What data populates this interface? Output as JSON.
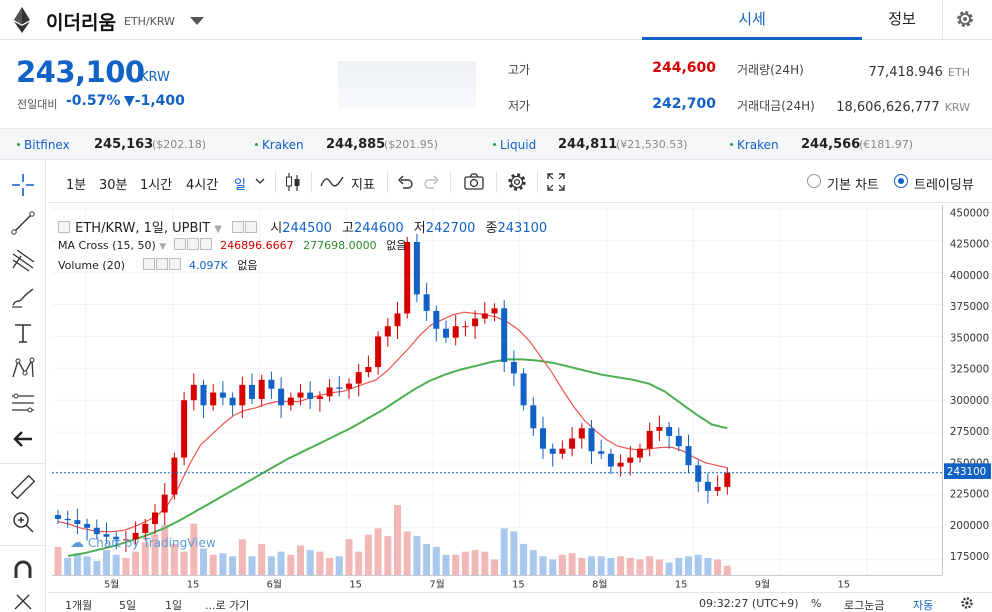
{
  "header": {
    "coin_name": "이더리움",
    "pair": "ETH/KRW",
    "tab_price": "시세",
    "tab_info": "정보"
  },
  "summary": {
    "price": "243,100",
    "currency": "KRW",
    "change_label": "전일대비",
    "change_pct": "-0.57%",
    "change_amt": "▼-1,400",
    "high_label": "고가",
    "high": "244,600",
    "low_label": "저가",
    "low": "242,700",
    "vol_label": "거래량(24H)",
    "vol": "77,418.946",
    "vol_unit": "ETH",
    "amt_label": "거래대금(24H)",
    "amt": "18,606,626,777",
    "amt_unit": "KRW",
    "colors": {
      "up": "#d60000",
      "down": "#1261c4"
    }
  },
  "ticker": [
    {
      "exchange": "Bitfinex",
      "price": "245,163",
      "usd": "($202.18)"
    },
    {
      "exchange": "Kraken",
      "price": "244,885",
      "usd": "($201.95)"
    },
    {
      "exchange": "Liquid",
      "price": "244,811",
      "usd": "(¥21,530.53)"
    },
    {
      "exchange": "Kraken",
      "price": "244,566",
      "usd": "(€181.97)"
    }
  ],
  "left_tools": [
    "crosshair-icon",
    "trend-line-icon",
    "pitchfork-icon",
    "brush-icon",
    "text-icon",
    "pattern-icon",
    "fib-icon",
    "back-arrow-icon",
    "ruler-icon",
    "zoom-icon",
    "magnet-icon",
    "trash-icon"
  ],
  "toolbar": {
    "intervals": [
      "1분",
      "30분",
      "1시간",
      "4시간",
      "일"
    ],
    "indicators": "지표",
    "basic_chart": "기본 차트",
    "tradingview": "트레이딩뷰"
  },
  "legend": {
    "title": "ETH/KRW, 1일, UPBIT",
    "o_label": "시",
    "o": "244500",
    "h_label": "고",
    "h": "244600",
    "l_label": "저",
    "l": "242700",
    "c_label": "종",
    "c": "243100",
    "ma_label": "MA Cross (15, 50)",
    "ma1": "246896.6667",
    "ma2": "277698.0000",
    "ma_none": "없음",
    "vol_label": "Volume (20)",
    "vol": "4.097K",
    "vol_none": "없음",
    "watermark": "Chart by TradingView"
  },
  "bottom": {
    "ranges": [
      "1개월",
      "5일",
      "1일",
      "...로 가기"
    ],
    "time": "09:32:27 (UTC+9)",
    "pct": "%",
    "log": "로그눈금",
    "auto": "자동"
  },
  "chart_data": {
    "type": "candlestick",
    "title": "ETH/KRW, 1일, UPBIT",
    "y_ticks": [
      175000,
      200000,
      225000,
      250000,
      275000,
      300000,
      325000,
      350000,
      375000,
      400000,
      425000,
      450000
    ],
    "y_range": [
      163000,
      453000
    ],
    "x_ticks": [
      "5월",
      "15",
      "6월",
      "15",
      "7월",
      "15",
      "8월",
      "15",
      "9월",
      "15"
    ],
    "last_price": 243100,
    "close_path": [
      207000,
      206000,
      203000,
      200000,
      195000,
      193000,
      191000,
      191000,
      196000,
      203000,
      212000,
      226000,
      255000,
      300000,
      312000,
      296000,
      306000,
      302000,
      296000,
      312000,
      301000,
      316000,
      309000,
      296000,
      302000,
      306000,
      301000,
      303000,
      310000,
      309000,
      313000,
      322000,
      326000,
      350000,
      358000,
      368000,
      424000,
      383000,
      370000,
      356000,
      349000,
      358000,
      358000,
      364000,
      368000,
      372000,
      330000,
      321000,
      296000,
      278000,
      262000,
      258000,
      262000,
      270000,
      278000,
      260000,
      258000,
      248000,
      251000,
      255000,
      262000,
      276000,
      279000,
      272000,
      264000,
      249000,
      236000,
      229000,
      232000,
      243100
    ],
    "ma_fast_path": [
      205000,
      203000,
      200000,
      198000,
      197000,
      197000,
      198000,
      201000,
      205000,
      209000,
      218000,
      232000,
      250000,
      265000,
      273000,
      281000,
      288000,
      292000,
      294000,
      297000,
      299000,
      299000,
      299000,
      302000,
      304000,
      306000,
      307000,
      310000,
      313000,
      316000,
      323000,
      332000,
      341000,
      351000,
      359000,
      363000,
      367000,
      369000,
      368000,
      367000,
      365000,
      361000,
      355000,
      346000,
      334000,
      322000,
      308000,
      295000,
      284000,
      276000,
      269000,
      264000,
      262000,
      261000,
      262000,
      263000,
      263000,
      260000,
      255000,
      251000,
      249000,
      247000
    ],
    "ma_slow_path": [
      178000,
      180000,
      183000,
      186000,
      190000,
      194000,
      199000,
      205000,
      212000,
      219000,
      226000,
      233000,
      240000,
      247000,
      254000,
      260000,
      266000,
      272000,
      278000,
      285000,
      292000,
      300000,
      308000,
      315000,
      320000,
      324000,
      327000,
      330000,
      332000,
      332000,
      331000,
      329000,
      326000,
      323000,
      320000,
      318000,
      316000,
      313000,
      307000,
      298000,
      289000,
      281000,
      278000
    ],
    "volume_path": [
      1.8,
      1.1,
      1.4,
      1.2,
      0.9,
      1.6,
      1.3,
      1.1,
      1.5,
      2.1,
      2.6,
      3.2,
      2.0,
      1.5,
      3.3,
      1.7,
      1.3,
      1.4,
      1.2,
      2.3,
      1.2,
      2.0,
      1.2,
      1.5,
      1.3,
      1.9,
      1.6,
      1.5,
      1.1,
      1.2,
      2.3,
      1.5,
      2.6,
      3.0,
      2.5,
      4.5,
      2.8,
      2.5,
      2.0,
      1.8,
      1.3,
      1.3,
      1.5,
      1.6,
      1.5,
      1.0,
      3.0,
      2.8,
      2.0,
      1.6,
      1.2,
      1.0,
      1.3,
      1.4,
      1.1,
      1.2,
      1.2,
      1.1,
      1.2,
      1.1,
      1.0,
      1.2,
      1.0,
      0.8,
      1.1,
      1.2,
      1.3,
      1.1,
      1.0,
      0.6
    ]
  }
}
